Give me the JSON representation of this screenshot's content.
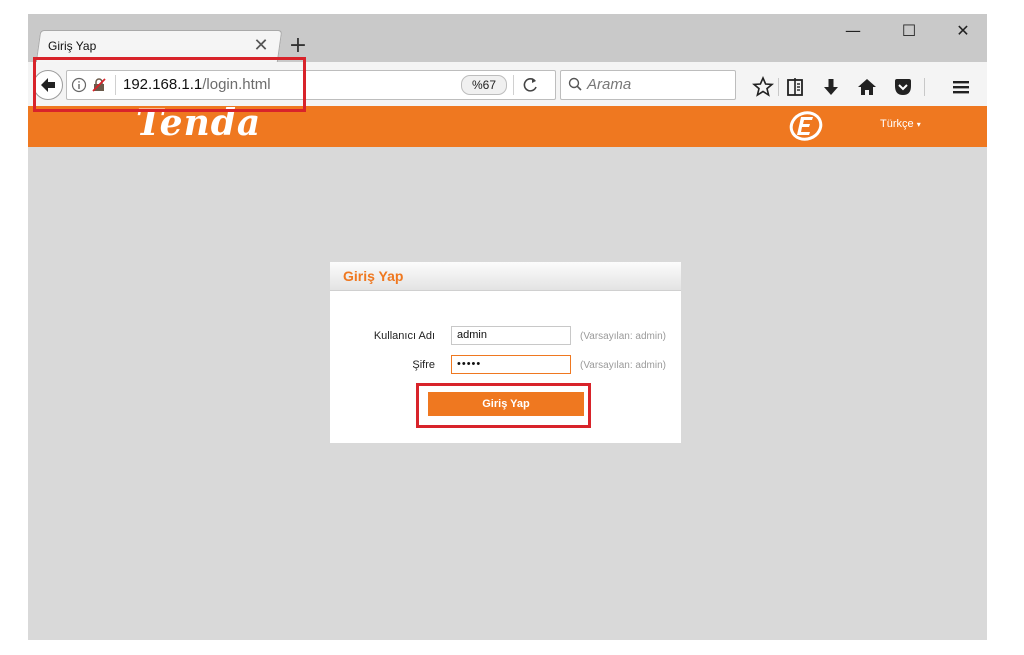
{
  "browser": {
    "tab_title": "Giriş Yap",
    "url_host": "192.168.1.1",
    "url_path": "/login.html",
    "zoom": "%67",
    "search_placeholder": "Arama"
  },
  "header": {
    "brand": "Tenda",
    "language": "Türkçe"
  },
  "login": {
    "title": "Giriş Yap",
    "username_label": "Kullanıcı Adı",
    "username_value": "admin",
    "username_hint": "(Varsayılan: admin)",
    "password_label": "Şifre",
    "password_value": "•••••",
    "password_hint": "(Varsayılan: admin)",
    "submit_label": "Giriş Yap"
  },
  "colors": {
    "brand_orange": "#ef7820",
    "highlight_red": "#d8232a"
  }
}
